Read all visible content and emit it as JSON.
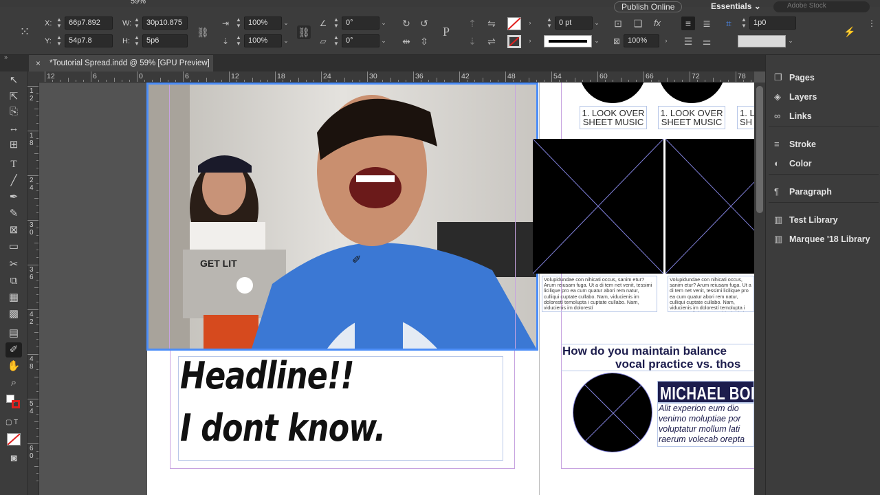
{
  "control_bar": {
    "x_label": "X:",
    "x_value": "66p7.892",
    "y_label": "Y:",
    "y_value": "54p7.8",
    "w_label": "W:",
    "w_value": "30p10.875",
    "h_label": "H:",
    "h_value": "5p6",
    "scale_x": "100%",
    "scale_y": "100%",
    "rotate": "0°",
    "shear": "0°",
    "stroke_weight": "0 pt",
    "opacity": "100%",
    "gap_value": "1p0",
    "publish_label": "Publish Online",
    "workspace_label": "Essentials",
    "search_placeholder": "Adobe Stock",
    "zoom_label": "59%"
  },
  "document_tab": {
    "title": "*Toutorial Spread.indd @ 59% [GPU Preview]",
    "close": "×"
  },
  "ruler_h": [
    "12",
    "6",
    "0",
    "6",
    "12",
    "18",
    "24",
    "30",
    "36",
    "42",
    "48",
    "54",
    "60",
    "66",
    "72",
    "78"
  ],
  "ruler_v": [
    [
      "1",
      "2"
    ],
    [
      "1",
      "8"
    ],
    [
      "2",
      "4"
    ],
    [
      "3",
      "0"
    ],
    [
      "3",
      "6"
    ],
    [
      "4",
      "2"
    ],
    [
      "4",
      "8"
    ],
    [
      "5",
      "4"
    ],
    [
      "6",
      "0"
    ]
  ],
  "canvas": {
    "headline_line1": "Headline!!",
    "headline_line2": "I dont know.",
    "step_caption_line1": "1. LOOK OVER",
    "step_caption_line2": "SHEET MUSIC",
    "step_caption_partial1": "1. L",
    "step_caption_partial2": "SH",
    "body_text": "Volupidundae con nihicati occus, sanim etur? Arum reiusam fuga. Ut a di tem net venit, tessimi licilique pro ea cum quatur abori rem natur, culliqui cuptate cullabo. Nam, viducienis im dolorestí temolupta i cuptate cullabo. Nam, viducienis im dolorestí",
    "question_line1": "How do you maintain balance",
    "question_line2": "vocal practice vs. thos",
    "name_label": "MICHAEL BOL",
    "quote_text": "Alit experion eum dio venimo moluptiae por voluptatur mollum lati raerum volecab orepta"
  },
  "panel": {
    "items": [
      {
        "icon": "pages-icon",
        "glyph": "❐",
        "label": "Pages"
      },
      {
        "icon": "layers-icon",
        "glyph": "◈",
        "label": "Layers"
      },
      {
        "icon": "links-icon",
        "glyph": "∞",
        "label": "Links"
      },
      {
        "icon": "stroke-icon",
        "glyph": "≡",
        "label": "Stroke"
      },
      {
        "icon": "color-icon",
        "glyph": "◐",
        "label": "Color"
      },
      {
        "icon": "paragraph-icon",
        "glyph": "¶",
        "label": "Paragraph"
      },
      {
        "icon": "library-icon",
        "glyph": "▥",
        "label": "Test Library"
      },
      {
        "icon": "library-icon",
        "glyph": "▥",
        "label": "Marquee '18 Library"
      }
    ]
  },
  "colors": {
    "selection": "#4b8df8",
    "ui_dark": "#3c3c3c",
    "pasteboard": "#535353",
    "heading_navy": "#1d1d4d"
  }
}
